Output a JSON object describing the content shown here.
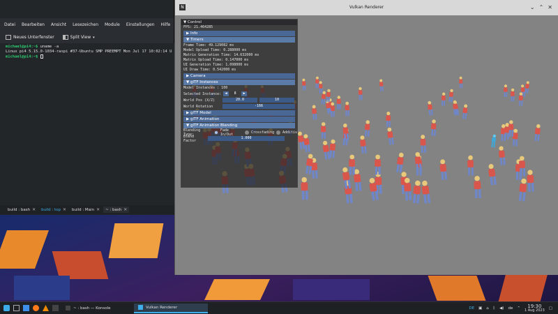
{
  "konsole": {
    "menu": [
      "Datei",
      "Bearbeiten",
      "Ansicht",
      "Lesezeichen",
      "Module",
      "Einstellungen",
      "Hilfe"
    ],
    "toolbar": {
      "new_window": "Neues Unterfenster",
      "split_view": "Split View"
    },
    "terminal": {
      "line1_user": "michael@pi4:~$",
      "line1_cmd": " uname -a",
      "line2": "Linux pi4 5.15.0-1034-raspi #37-Ubuntu SMP PREEMPT Mon Jul 17 10:02:14 U",
      "line3_user": "michael@pi4:~$"
    },
    "tabs": [
      "build : bash",
      "build : top",
      "build : Main",
      "~ : bash"
    ]
  },
  "vulkan": {
    "title": "Vulkan Renderer",
    "controls": {
      "minimize": "⌄",
      "maximize": "⌃",
      "close": "✕"
    }
  },
  "imgui": {
    "title": "▼ Control",
    "fps": "FPS: 21.464285",
    "info_header": "▶ Info",
    "timers_header": "▼ Timers",
    "timers": [
      "Frame Time: 49.129082 ms",
      "Model Upload Time: 0.288000 ms",
      "Matrix Generation Time: 14.632000 ms",
      "Matrix Upload Time: 0.147000 ms",
      "UI Generation Time: 1.098000 ms",
      "UI Draw Time: 0.542000 ms"
    ],
    "camera_header": "▶ Camera",
    "instances_header": "▼ glTF Instances",
    "model_instances": "Model Instances : 100",
    "selected_instance_label": "Selected Instance:",
    "selected_instance_value": "8",
    "world_pos_label": "World Pos (X/Z)",
    "world_pos_x": "20.0",
    "world_pos_z": "10",
    "world_rotation_label": "World Rotation",
    "world_rotation_value": "-166",
    "model_header": "▶ glTF Model",
    "animation_header": "▶ glTF Animation",
    "blending_header": "▼ glTF Animation Blending",
    "blending_type_label": "Blending Type:",
    "blending_options": [
      "Fade In/Out",
      "Crossfading",
      "Additiv"
    ],
    "blend_factor_label": "Blend Factor",
    "blend_factor_value": "1.000"
  },
  "taskbar": {
    "tasks": [
      "~ : bash — Konsole",
      "Vulkan Renderer"
    ],
    "lang": "de",
    "keyboard": "DE",
    "time": "19:30",
    "date": "1 Aug 2023"
  },
  "colors": {
    "accent": "#3daee9",
    "imgui_header": "#4a6896",
    "prompt": "#2ecc71",
    "figure_shirt": "#d9564c",
    "figure_selected": "#3fa7d6"
  }
}
